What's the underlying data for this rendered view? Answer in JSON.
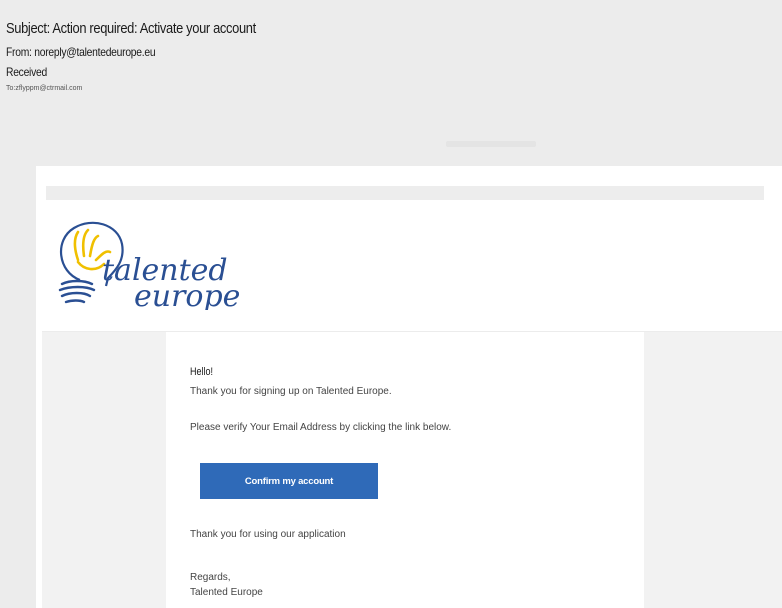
{
  "email": {
    "subject": "Subject: Action required: Activate your account",
    "from": "From: noreply@talentedeurope.eu",
    "received": "Received",
    "to": "To:zflyppm@ctrmail.com"
  },
  "brand": {
    "logo_line1": "talented",
    "logo_line2": "europe",
    "blue": "#2a4f93",
    "yellow": "#f0c000"
  },
  "message": {
    "greeting": "Hello!",
    "line1": "Thank you for signing up on Talented Europe.",
    "line2": "Please verify Your Email Address by clicking the link below.",
    "button_label": "Confirm my account",
    "thanks": "Thank you for using our application",
    "regards": "Regards,",
    "signature": "Talented Europe"
  },
  "colors": {
    "button": "#2f6ab8"
  }
}
